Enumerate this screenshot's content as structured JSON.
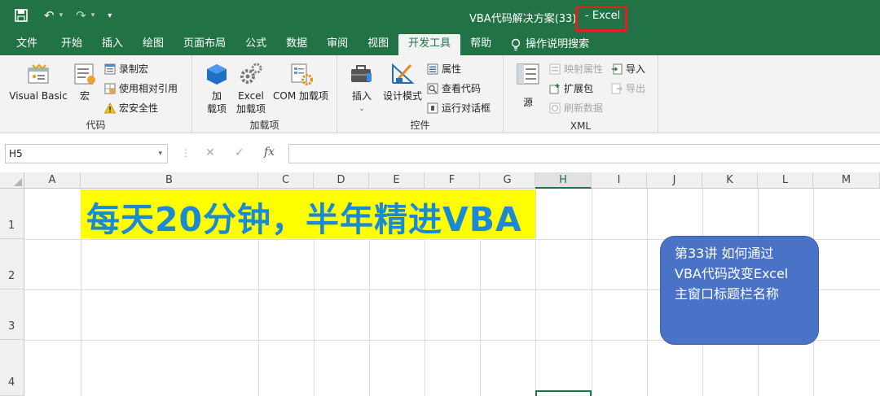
{
  "window": {
    "title": "VBA代码解决方案(33)",
    "app_name": "- Excel"
  },
  "quick_access": {
    "save_icon": "save-icon",
    "undo_icon": "undo-icon",
    "redo_icon": "redo-icon",
    "customize_icon": "customize-icon"
  },
  "tabs": [
    "文件",
    "开始",
    "插入",
    "绘图",
    "页面布局",
    "公式",
    "数据",
    "审阅",
    "视图",
    "开发工具",
    "帮助"
  ],
  "active_tab": "开发工具",
  "tell_me": "操作说明搜索",
  "ribbon": {
    "code": {
      "label": "代码",
      "visual_basic": "Visual Basic",
      "macros": "宏",
      "record_macro": "录制宏",
      "relative_ref": "使用相对引用",
      "macro_security": "宏安全性"
    },
    "addins": {
      "label": "加载项",
      "addins_line1": "加",
      "addins_line2": "载项",
      "excel_addins_line1": "Excel",
      "excel_addins_line2": "加载项",
      "com_addins": "COM 加载项"
    },
    "controls": {
      "label": "控件",
      "insert": "插入",
      "design_mode": "设计模式",
      "properties": "属性",
      "view_code": "查看代码",
      "run_dialog": "运行对话框"
    },
    "xml": {
      "label": "XML",
      "source": "源",
      "map_properties": "映射属性",
      "expansion_packs": "扩展包",
      "refresh_data": "刷新数据",
      "import": "导入",
      "export": "导出"
    }
  },
  "formula_bar": {
    "name_box": "H5",
    "fx": "fx",
    "value": ""
  },
  "columns": [
    "A",
    "B",
    "C",
    "D",
    "E",
    "F",
    "G",
    "H",
    "I",
    "J",
    "K",
    "L",
    "M"
  ],
  "selected_column": "H",
  "rows": [
    "1",
    "2",
    "3",
    "4"
  ],
  "banner": "每天20分钟，半年精进VBA",
  "note": {
    "line1": "第33讲 如何通过",
    "line2": "VBA代码改变Excel",
    "line3": "主窗口标题栏名称"
  },
  "colors": {
    "excel_green": "#217346",
    "banner_fill": "#ffff00",
    "banner_text": "#1a8ad6",
    "note_fill": "#4a72c6",
    "highlight_box": "#e02020"
  }
}
